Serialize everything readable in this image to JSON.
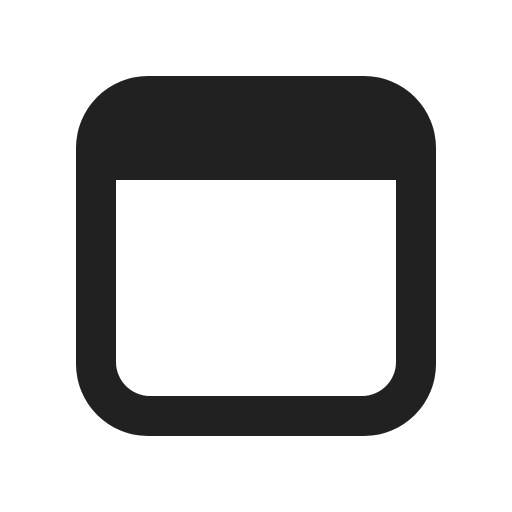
{
  "icon": {
    "name": "calendar-blank-icon",
    "color": "#212121",
    "background": "#ffffff"
  }
}
